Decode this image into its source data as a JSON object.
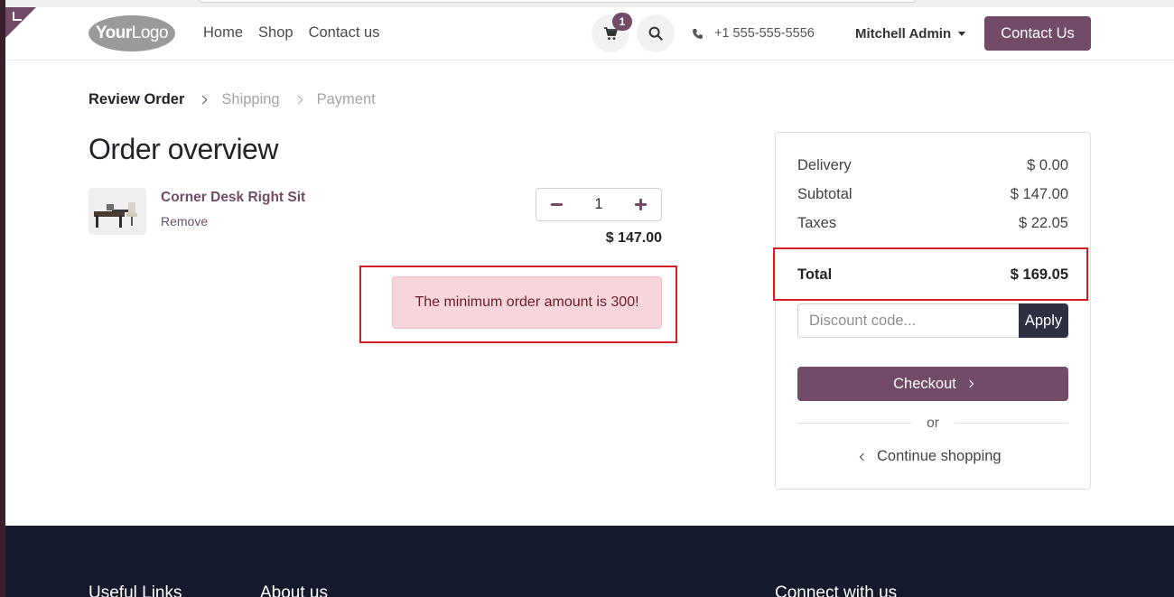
{
  "header": {
    "logo_text_bold": "Your",
    "logo_text": "Logo",
    "nav": [
      "Home",
      "Shop",
      "Contact us"
    ],
    "cart_count": "1",
    "phone": "+1 555-555-5556",
    "user": "Mitchell Admin",
    "contact_button": "Contact Us",
    "accent_color": "#714b67"
  },
  "steps": [
    "Review Order",
    "Shipping",
    "Payment"
  ],
  "page_title": "Order overview",
  "cart_line": {
    "product_name": "Corner Desk Right Sit",
    "remove_label": "Remove",
    "quantity": "1",
    "price": "$ 147.00"
  },
  "alert": {
    "message": "The minimum order amount is 300!"
  },
  "summary": {
    "delivery_label": "Delivery",
    "delivery_value": "$ 0.00",
    "subtotal_label": "Subtotal",
    "subtotal_value": "$ 147.00",
    "taxes_label": "Taxes",
    "taxes_value": "$ 22.05",
    "total_label": "Total",
    "total_value": "$ 169.05",
    "discount_placeholder": "Discount code...",
    "apply_label": "Apply",
    "checkout_label": "Checkout",
    "or_label": "or",
    "continue_label": "Continue shopping"
  },
  "footer": {
    "col1": "Useful Links",
    "col2": "About us",
    "col3": "Connect with us"
  }
}
